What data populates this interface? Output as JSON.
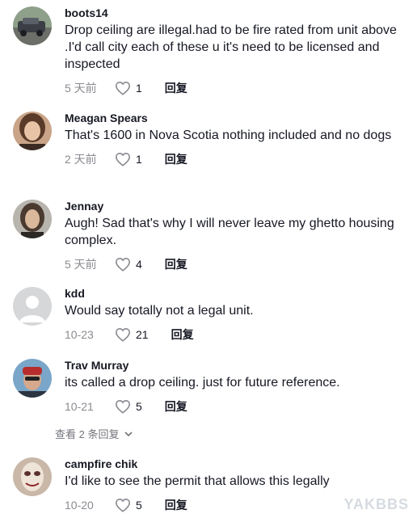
{
  "colors": {
    "text": "#161823",
    "muted": "#8a8b91",
    "like_icon": "#8a8b91"
  },
  "comments": [
    {
      "username": "boots14",
      "text": "Drop ceiling are illegal.had to be fire rated from unit above .I'd call city each of these u it's need to be licensed and inspected",
      "date": "5 天前",
      "likes": "1",
      "reply": "回复",
      "avatar": "car-photo"
    },
    {
      "username": "Meagan Spears",
      "text": "That's 1600 in Nova Scotia nothing included and no dogs",
      "date": "2 天前",
      "likes": "1",
      "reply": "回复",
      "avatar": "woman-photo"
    },
    {
      "username": "Jennay",
      "text": "Augh! Sad that's why I will never leave my ghetto housing complex.",
      "date": "5 天前",
      "likes": "4",
      "reply": "回复",
      "avatar": "woman-photo-2"
    },
    {
      "username": "kdd",
      "text": "Would say totally not a legal unit.",
      "date": "10-23",
      "likes": "21",
      "reply": "回复",
      "avatar": "default-avatar"
    },
    {
      "username": "Trav Murray",
      "text": "its called a drop ceiling. just for future reference.",
      "date": "10-21",
      "likes": "5",
      "reply": "回复",
      "avatar": "man-photo"
    },
    {
      "username": "campfire chik",
      "text": "I'd like to see the permit that allows this legally",
      "date": "10-20",
      "likes": "5",
      "reply": "回复",
      "avatar": "mask-photo"
    }
  ],
  "view_replies": "查看 2 条回复",
  "watermark": "YAKBBS"
}
